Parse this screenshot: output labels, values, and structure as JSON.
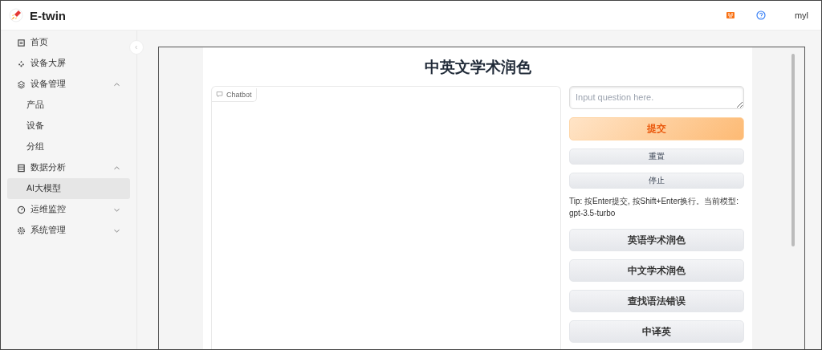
{
  "header": {
    "brand": "E-twin",
    "user": "myl"
  },
  "sidebar": {
    "items": [
      {
        "label": "首页",
        "selected": false
      },
      {
        "label": "设备大屏",
        "selected": false
      },
      {
        "label": "设备管理",
        "selected": false,
        "expanded": true,
        "children": [
          {
            "label": "产品",
            "selected": false
          },
          {
            "label": "设备",
            "selected": false
          },
          {
            "label": "分组",
            "selected": false
          }
        ]
      },
      {
        "label": "数据分析",
        "selected": false,
        "expanded": true,
        "children": [
          {
            "label": "AI大模型",
            "selected": true
          }
        ]
      },
      {
        "label": "运维监控",
        "selected": false,
        "expanded": false
      },
      {
        "label": "系统管理",
        "selected": false,
        "expanded": false
      }
    ]
  },
  "app": {
    "title": "中英文学术润色",
    "chatbot_label": "Chatbot",
    "input": {
      "placeholder": "Input question here."
    },
    "buttons": [
      {
        "label": "提交",
        "kind": "primary"
      },
      {
        "label": "重置",
        "kind": "small"
      },
      {
        "label": "停止",
        "kind": "small"
      }
    ],
    "tip": "Tip: 按Enter提交, 按Shift+Enter换行。当前模型: gpt-3.5-turbo",
    "functions": [
      {
        "label": "英语学术润色"
      },
      {
        "label": "中文学术润色"
      },
      {
        "label": "查找语法错误"
      },
      {
        "label": "中译英"
      }
    ]
  }
}
